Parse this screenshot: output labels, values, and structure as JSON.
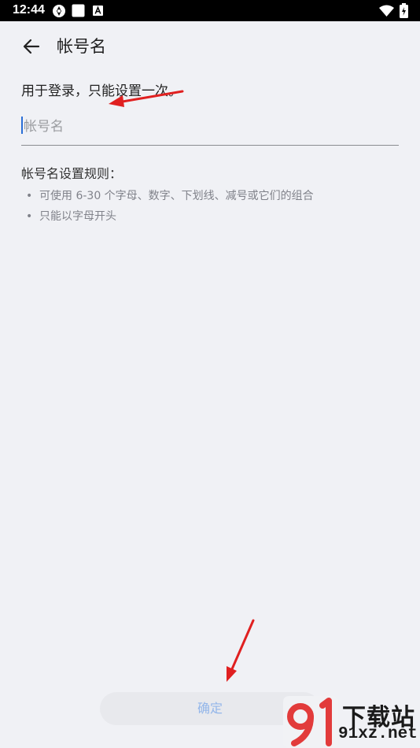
{
  "status_bar": {
    "time": "12:44"
  },
  "app_bar": {
    "title": "帐号名"
  },
  "form": {
    "hint": "用于登录，只能设置一次。",
    "input_placeholder": "帐号名",
    "input_value": ""
  },
  "rules": {
    "title": "帐号名设置规则：",
    "items": [
      "可使用 6-30 个字母、数字、下划线、减号或它们的组合",
      "只能以字母开头"
    ]
  },
  "confirm_button": {
    "label": "确定"
  },
  "watermark": {
    "top_text": "下载站",
    "bottom_text": "91xz.net"
  },
  "colors": {
    "accent": "#2b6fd6",
    "button_text_disabled": "#93b6ea",
    "annotation_arrow": "#e02020",
    "background": "#f0f1f5"
  }
}
